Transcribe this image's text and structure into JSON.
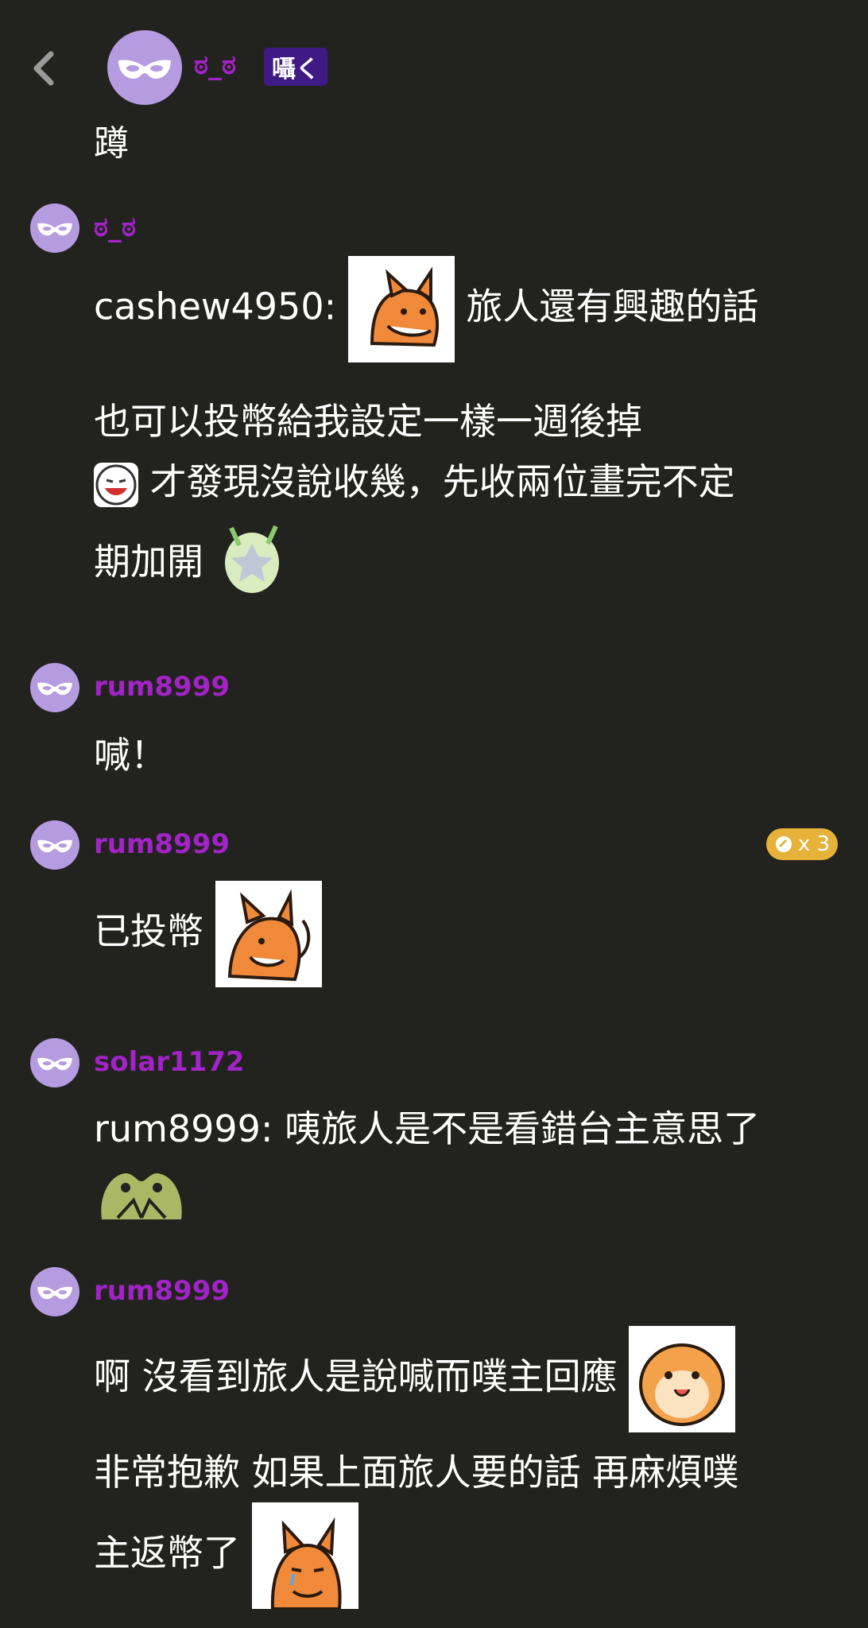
{
  "header": {
    "back_icon": "chevron-left-icon",
    "op_name": "ಠ_ಠ",
    "op_badge": "囁く",
    "op_text": "蹲"
  },
  "comments": [
    {
      "name": "ಠ_ಠ",
      "line1_prefix": "cashew4950:",
      "line1_suffix": "旅人還有興趣的話",
      "line2": "也可以投幣給我設定一樣一週後掉",
      "line3": "才發現沒說收幾，先收兩位畫完不定",
      "line4": "期加開"
    },
    {
      "name": "rum8999",
      "text": "喊！"
    },
    {
      "name": "rum8999",
      "text": "已投幣",
      "coin_label": "x 3"
    },
    {
      "name": "solar1172",
      "text": "rum8999: 咦旅人是不是看錯台主意思了"
    },
    {
      "name": "rum8999",
      "line1": "啊 沒看到旅人是說喊而噗主回應",
      "line2": "非常抱歉 如果上面旅人要的話 再麻煩噗",
      "line3": "主返幣了"
    }
  ],
  "colors": {
    "background": "#22231f",
    "username": "#a223c6",
    "badge": "#3f1a84",
    "coin": "#e6b23a",
    "avatar": "#b59be0"
  }
}
